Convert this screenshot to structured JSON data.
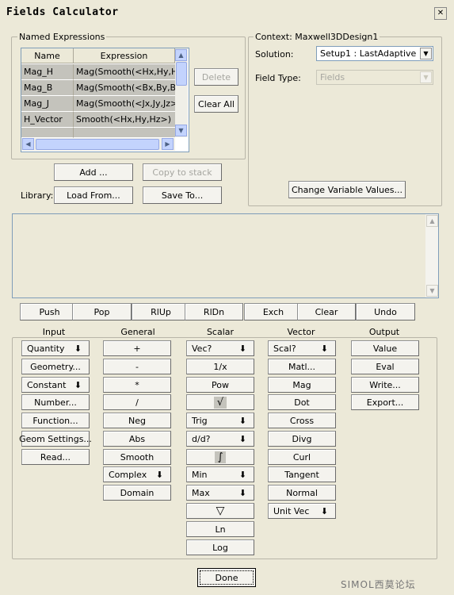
{
  "window": {
    "title": "Fields Calculator",
    "close_glyph": "✕"
  },
  "named_expressions": {
    "group_label": "Named Expressions",
    "columns": [
      "Name",
      "Expression"
    ],
    "rows": [
      {
        "name": "Mag_H",
        "expression": "Mag(Smooth(<Hx,Hy,Hz>))"
      },
      {
        "name": "Mag_B",
        "expression": "Mag(Smooth(<Bx,By,Bz>))"
      },
      {
        "name": "Mag_J",
        "expression": "Mag(Smooth(<Jx,Jy,Jz>))"
      },
      {
        "name": "H_Vector",
        "expression": "Smooth(<Hx,Hy,Hz>)"
      }
    ],
    "delete_label": "Delete",
    "clear_all_label": "Clear All",
    "add_label": "Add ...",
    "copy_to_stack_label": "Copy to stack",
    "library_label": "Library:",
    "load_from_label": "Load From...",
    "save_to_label": "Save To..."
  },
  "context": {
    "group_label": "Context: Maxwell3DDesign1",
    "solution_label": "Solution:",
    "solution_value": "Setup1 : LastAdaptive",
    "field_type_label": "Field Type:",
    "field_type_value": "Fields",
    "change_variable_values_label": "Change Variable Values..."
  },
  "stack_ops": [
    "Push",
    "Pop",
    "RlUp",
    "RlDn",
    "Exch",
    "Clear",
    "Undo"
  ],
  "columns": {
    "input": {
      "header": "Input",
      "buttons": [
        "Quantity",
        "Geometry...",
        "Constant",
        "Number...",
        "Function...",
        "Geom Settings...",
        "Read..."
      ]
    },
    "general": {
      "header": "General",
      "buttons": [
        "+",
        "-",
        "*",
        "/",
        "Neg",
        "Abs",
        "Smooth",
        "Complex",
        "Domain"
      ]
    },
    "scalar": {
      "header": "Scalar",
      "buttons": [
        "Vec?",
        "1/x",
        "Pow",
        "√",
        "Trig",
        "d/d?",
        "∫",
        "Min",
        "Max",
        "▽",
        "Ln",
        "Log"
      ]
    },
    "vector": {
      "header": "Vector",
      "buttons": [
        "Scal?",
        "Matl...",
        "Mag",
        "Dot",
        "Cross",
        "Divg",
        "Curl",
        "Tangent",
        "Normal",
        "Unit Vec"
      ]
    },
    "output": {
      "header": "Output",
      "buttons": [
        "Value",
        "Eval",
        "Write...",
        "Export..."
      ]
    }
  },
  "done_label": "Done",
  "watermark": "SIMOL西莫论坛"
}
